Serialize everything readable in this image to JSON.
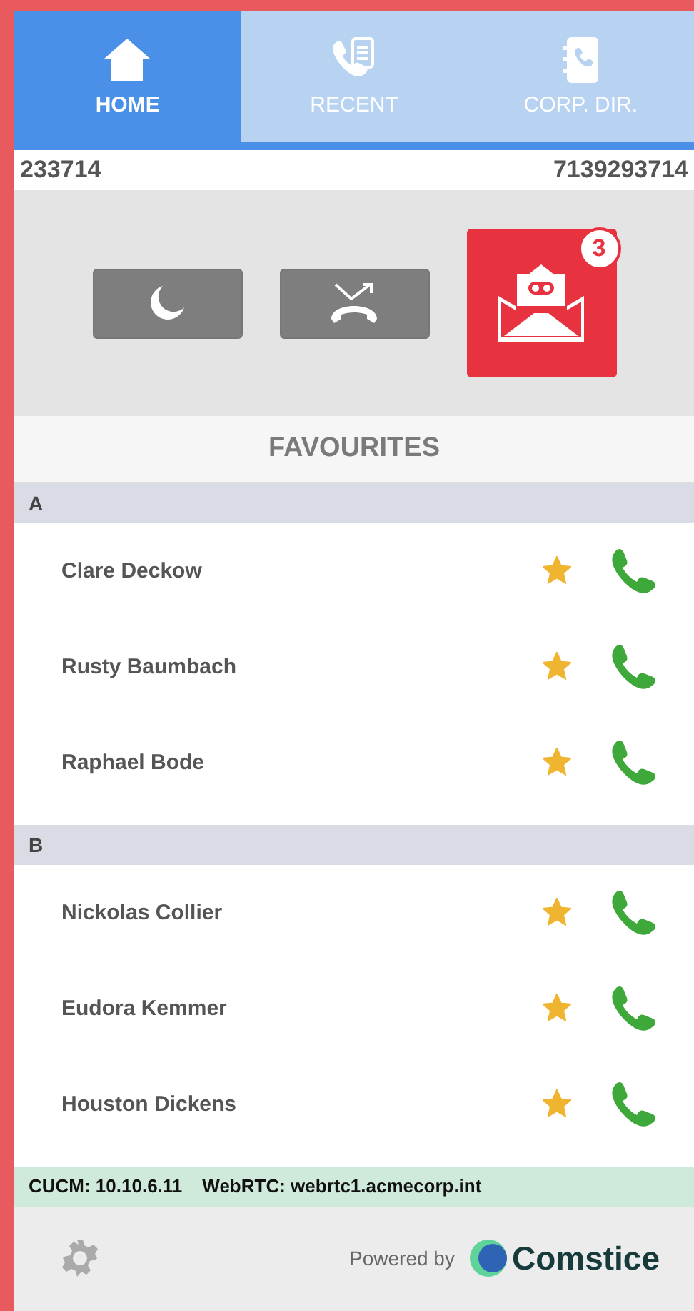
{
  "tabs": [
    {
      "label": "HOME",
      "kind": "home",
      "selected": true
    },
    {
      "label": "RECENT",
      "kind": "recent",
      "selected": false
    },
    {
      "label": "CORP. DIR.",
      "kind": "directory",
      "selected": false
    }
  ],
  "line": {
    "extension": "233714",
    "number": "7139293714"
  },
  "actions": [
    {
      "kind": "dnd"
    },
    {
      "kind": "forward"
    },
    {
      "kind": "voicemail",
      "badge": "3"
    }
  ],
  "favourites": {
    "title": "FAVOURITES",
    "groups": [
      {
        "letter": "A",
        "contacts": [
          {
            "name": "Clare Deckow",
            "favourite": true
          },
          {
            "name": "Rusty Baumbach",
            "favourite": true
          },
          {
            "name": "Raphael Bode",
            "favourite": true
          }
        ]
      },
      {
        "letter": "B",
        "contacts": [
          {
            "name": "Nickolas Collier",
            "favourite": true
          },
          {
            "name": "Eudora Kemmer",
            "favourite": true
          },
          {
            "name": "Houston Dickens",
            "favourite": true
          }
        ]
      }
    ]
  },
  "status_bar": [
    "CUCM: 10.10.6.11",
    "WebRTC: webrtc1.acmecorp.int"
  ],
  "footer": {
    "powered_by": "Powered by",
    "brand": "Comstice"
  }
}
